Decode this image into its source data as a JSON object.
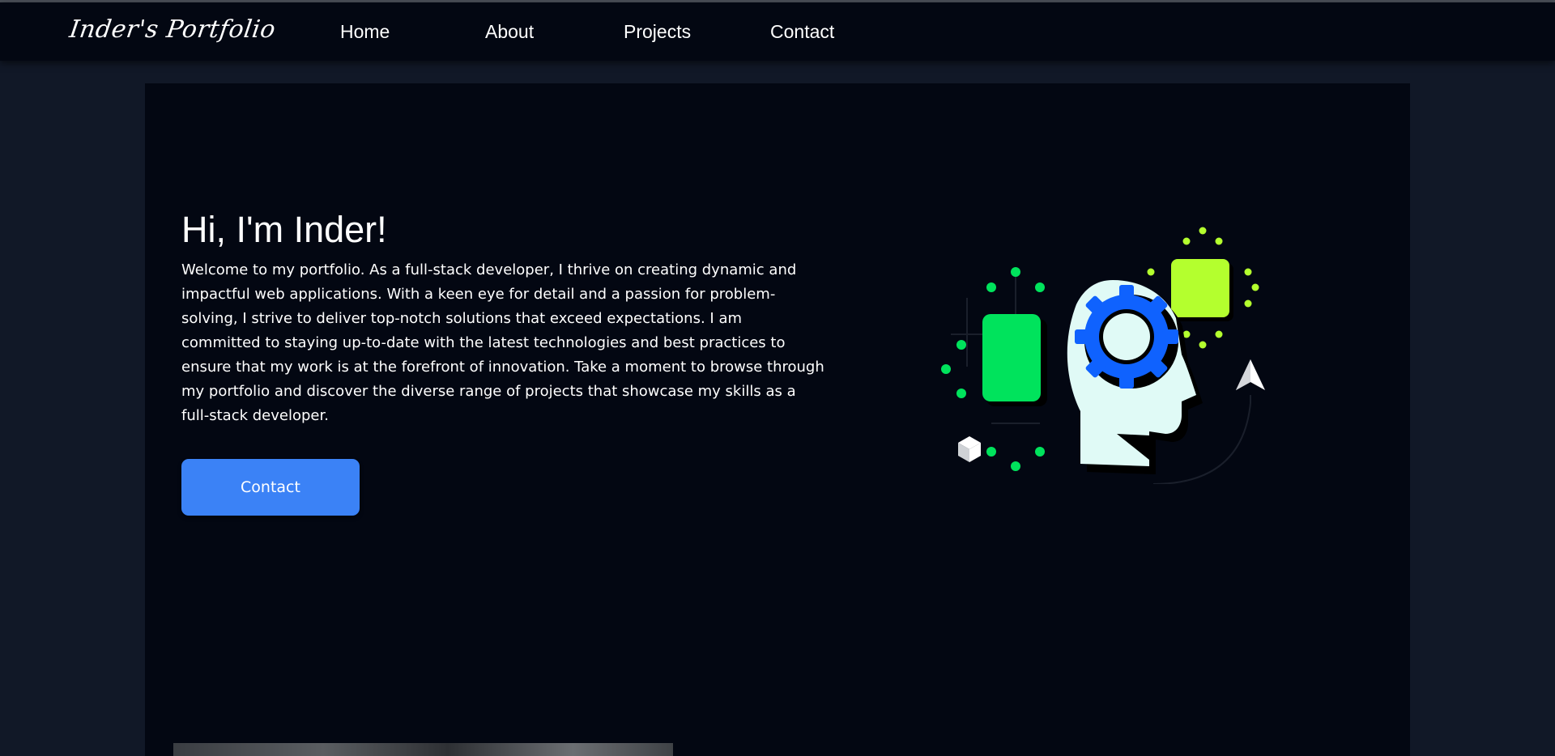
{
  "navbar": {
    "brand": "Inder's Portfolio",
    "links": [
      "Home",
      "About",
      "Projects",
      "Contact"
    ]
  },
  "hero": {
    "title": "Hi, I'm Inder!",
    "description": "Welcome to my portfolio. As a full-stack developer, I thrive on creating dynamic and impactful web applications. With a keen eye for detail and a passion for problem-solving, I strive to deliver top-notch solutions that exceed expectations. I am committed to staying up-to-date with the latest technologies and best practices to ensure that my work is at the forefront of innovation. Take a moment to browse through my portfolio and discover the diverse range of projects that showcase my skills as a full-stack developer.",
    "contact_button": "Contact"
  },
  "colors": {
    "page_bg": "#111827",
    "nav_bg": "#030712",
    "hero_bg": "#030712",
    "accent_blue": "#3b82f6",
    "illustration_green": "#00e35c",
    "illustration_lime": "#b4ff2e",
    "gear_blue": "#0f62fe"
  },
  "icons": [
    "head-gear-illustration",
    "paper-plane-icon",
    "cube-icon"
  ]
}
